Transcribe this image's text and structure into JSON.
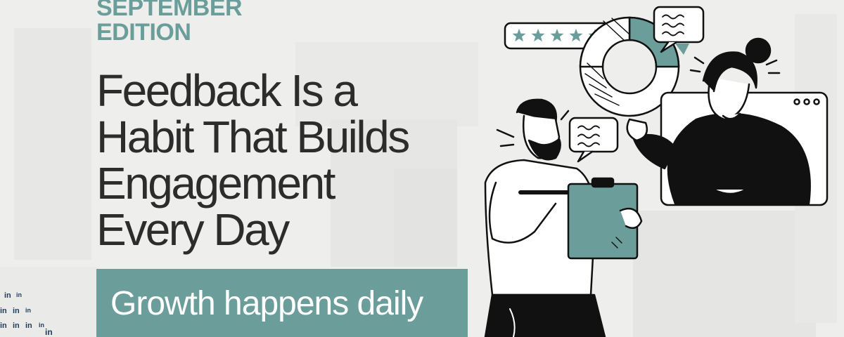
{
  "edition": {
    "line1": "SEPTEMBER",
    "line2": "EDITION"
  },
  "headline": {
    "line1": "Feedback Is a",
    "line2": "Habit That Builds",
    "line3": "Engagement",
    "line4": "Every Day"
  },
  "banner": {
    "text": "Growth happens daily"
  },
  "social_pattern": {
    "icon": "linkedin-icon",
    "label": "in"
  },
  "illustration": {
    "rating_stars": 5,
    "icons": [
      "star-icon",
      "speech-bubble-icon",
      "donut-chart-icon",
      "browser-window-icon",
      "clipboard-icon"
    ]
  },
  "colors": {
    "accent": "#6b9e9a",
    "text": "#2c2c2c",
    "background": "#eeeeec",
    "social": "#1f3b58"
  }
}
